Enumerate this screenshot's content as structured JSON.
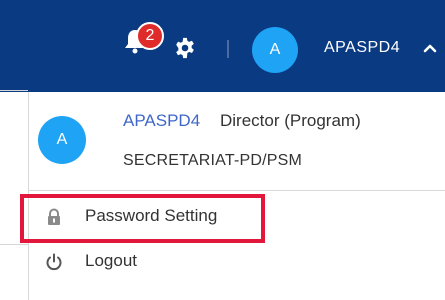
{
  "navbar": {
    "notification_count": "2",
    "avatar_initial": "A",
    "username": "APASPD4"
  },
  "dropdown": {
    "avatar_initial": "A",
    "username": "APASPD4",
    "role": "Director (Program)",
    "organization": "SECRETARIAT-PD/PSM",
    "items": [
      {
        "label": "Password Setting",
        "icon": "lock-icon"
      },
      {
        "label": "Logout",
        "icon": "power-icon"
      }
    ]
  },
  "colors": {
    "navbar_bg": "#0a3a82",
    "avatar_bg": "#1fa3f5",
    "badge_bg": "#e02b2b",
    "username_link": "#3f67c9",
    "highlight": "#e3173b"
  }
}
